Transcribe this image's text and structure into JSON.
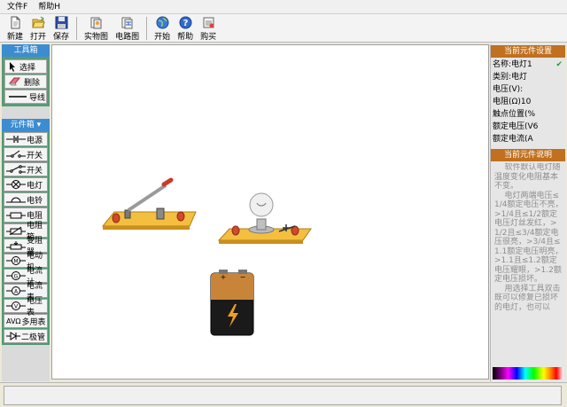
{
  "menubar": {
    "items": [
      {
        "label": "文件F"
      },
      {
        "label": "帮助H"
      }
    ]
  },
  "toolbar": {
    "buttons": [
      {
        "label": "新建",
        "icon": "new-document-icon"
      },
      {
        "label": "打开",
        "icon": "open-folder-icon"
      },
      {
        "label": "保存",
        "icon": "save-disk-icon"
      },
      {
        "label": "实物图",
        "icon": "physical-diagram-icon"
      },
      {
        "label": "电路图",
        "icon": "circuit-diagram-icon"
      },
      {
        "label": "开始",
        "icon": "start-globe-icon"
      },
      {
        "label": "帮助",
        "icon": "help-icon"
      },
      {
        "label": "购买",
        "icon": "buy-icon"
      }
    ]
  },
  "toolbox": {
    "title": "工具箱",
    "items": [
      {
        "label": "选择",
        "icon": "cursor-arrow-icon"
      },
      {
        "label": "删除",
        "icon": "eraser-icon"
      },
      {
        "label": "导线",
        "icon": "wire-line-icon"
      }
    ]
  },
  "components": {
    "title": "元件箱",
    "items": [
      {
        "label": "电源",
        "icon": "power-source-icon"
      },
      {
        "label": "开关",
        "icon": "switch-icon"
      },
      {
        "label": "开关",
        "icon": "switch-two-way-icon"
      },
      {
        "label": "电灯",
        "icon": "lamp-icon"
      },
      {
        "label": "电铃",
        "icon": "bell-icon"
      },
      {
        "label": "电阻",
        "icon": "resistor-icon"
      },
      {
        "label": "电阻箱",
        "icon": "resistor-box-icon"
      },
      {
        "label": "变阻器",
        "icon": "rheostat-icon"
      },
      {
        "label": "电动机",
        "icon": "motor-icon"
      },
      {
        "label": "电流计",
        "icon": "galvanometer-icon"
      },
      {
        "label": "电流表",
        "icon": "ammeter-icon"
      },
      {
        "label": "电压表",
        "icon": "voltmeter-icon"
      },
      {
        "label": "多用表",
        "icon": "multimeter-icon",
        "prefix": "AVΩ"
      },
      {
        "label": "二极管",
        "icon": "diode-icon"
      }
    ]
  },
  "properties": {
    "title": "当前元件设置",
    "rows": [
      {
        "label": "名称:电灯1"
      },
      {
        "label": "类别:电灯"
      },
      {
        "label": "电压(V):"
      },
      {
        "label": "电阻(Ω)10"
      },
      {
        "label": "触点位置(%"
      },
      {
        "label": "额定电压(V6"
      },
      {
        "label": "额定电流(A"
      }
    ],
    "checked": true
  },
  "description": {
    "title": "当前元件说明",
    "text": "    软件默认电灯随温度变化电阻基本不变。\n    电灯两端电压≤1/4额定电压不亮，>1/4且≤1/2额定电压灯丝发红，>1/2且≤3/4额定电压很亮，>3/4且≤1.1额定电压明亮，>1.1且≤1.2额定电压耀眼，>1.2额定电压损坏。\n    用选择工具双击既可以修复已损坏的电灯，也可以"
  },
  "canvas": {
    "components": [
      {
        "name": "knife-switch"
      },
      {
        "name": "lamp"
      },
      {
        "name": "battery"
      }
    ]
  },
  "colors": {
    "toolbox_header": "#3c8cd1",
    "component_bg": "#4f9a72",
    "property_header": "#c0701e",
    "board_wood": "#f2b432",
    "terminal_red": "#d24a2a",
    "battery_copper": "#c8853a"
  }
}
